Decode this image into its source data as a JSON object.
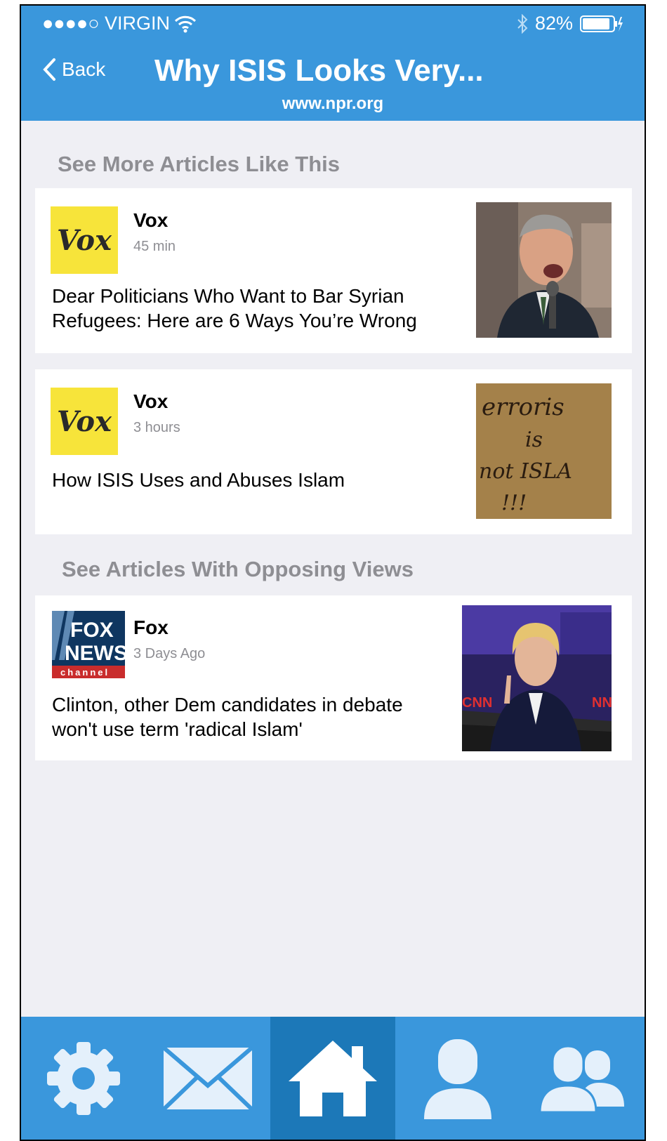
{
  "status_bar": {
    "carrier": "●●●●○ VIRGIN",
    "battery": "82%"
  },
  "nav": {
    "back_label": "Back",
    "title": "Why ISIS Looks Very...",
    "subtitle": "www.npr.org"
  },
  "sections": {
    "similar_header": "See More Articles Like This",
    "opposing_header": "See Articles With Opposing Views"
  },
  "articles": [
    {
      "source": "Vox",
      "logo_text": "Vox",
      "time": "45 min",
      "headline_line1": "Dear Politicians Who Want to Bar Syrian",
      "headline_line2": "Refugees: Here are 6 Ways You’re Wrong"
    },
    {
      "source": "Vox",
      "logo_text": "Vox",
      "time": "3 hours",
      "headline_line1": "How ISIS Uses and Abuses Islam",
      "sign_text": "Terrorism is not ISLAM !!!"
    },
    {
      "source": "Fox",
      "logo_line1": "FOX",
      "logo_line2": "NEWS",
      "logo_line3": "channel",
      "time": "3 Days Ago",
      "headline_line1": "Clinton, other Dem candidates in debate",
      "headline_line2": "won't use term 'radical Islam'"
    }
  ],
  "tabs": [
    {
      "icon": "gear-icon"
    },
    {
      "icon": "mail-icon"
    },
    {
      "icon": "home-icon",
      "active": true
    },
    {
      "icon": "person-icon"
    },
    {
      "icon": "group-icon"
    }
  ],
  "colors": {
    "accent": "#3a97dc",
    "active_tab": "#1c78b8",
    "vox_yellow": "#f7e43a",
    "background": "#efeff4"
  }
}
